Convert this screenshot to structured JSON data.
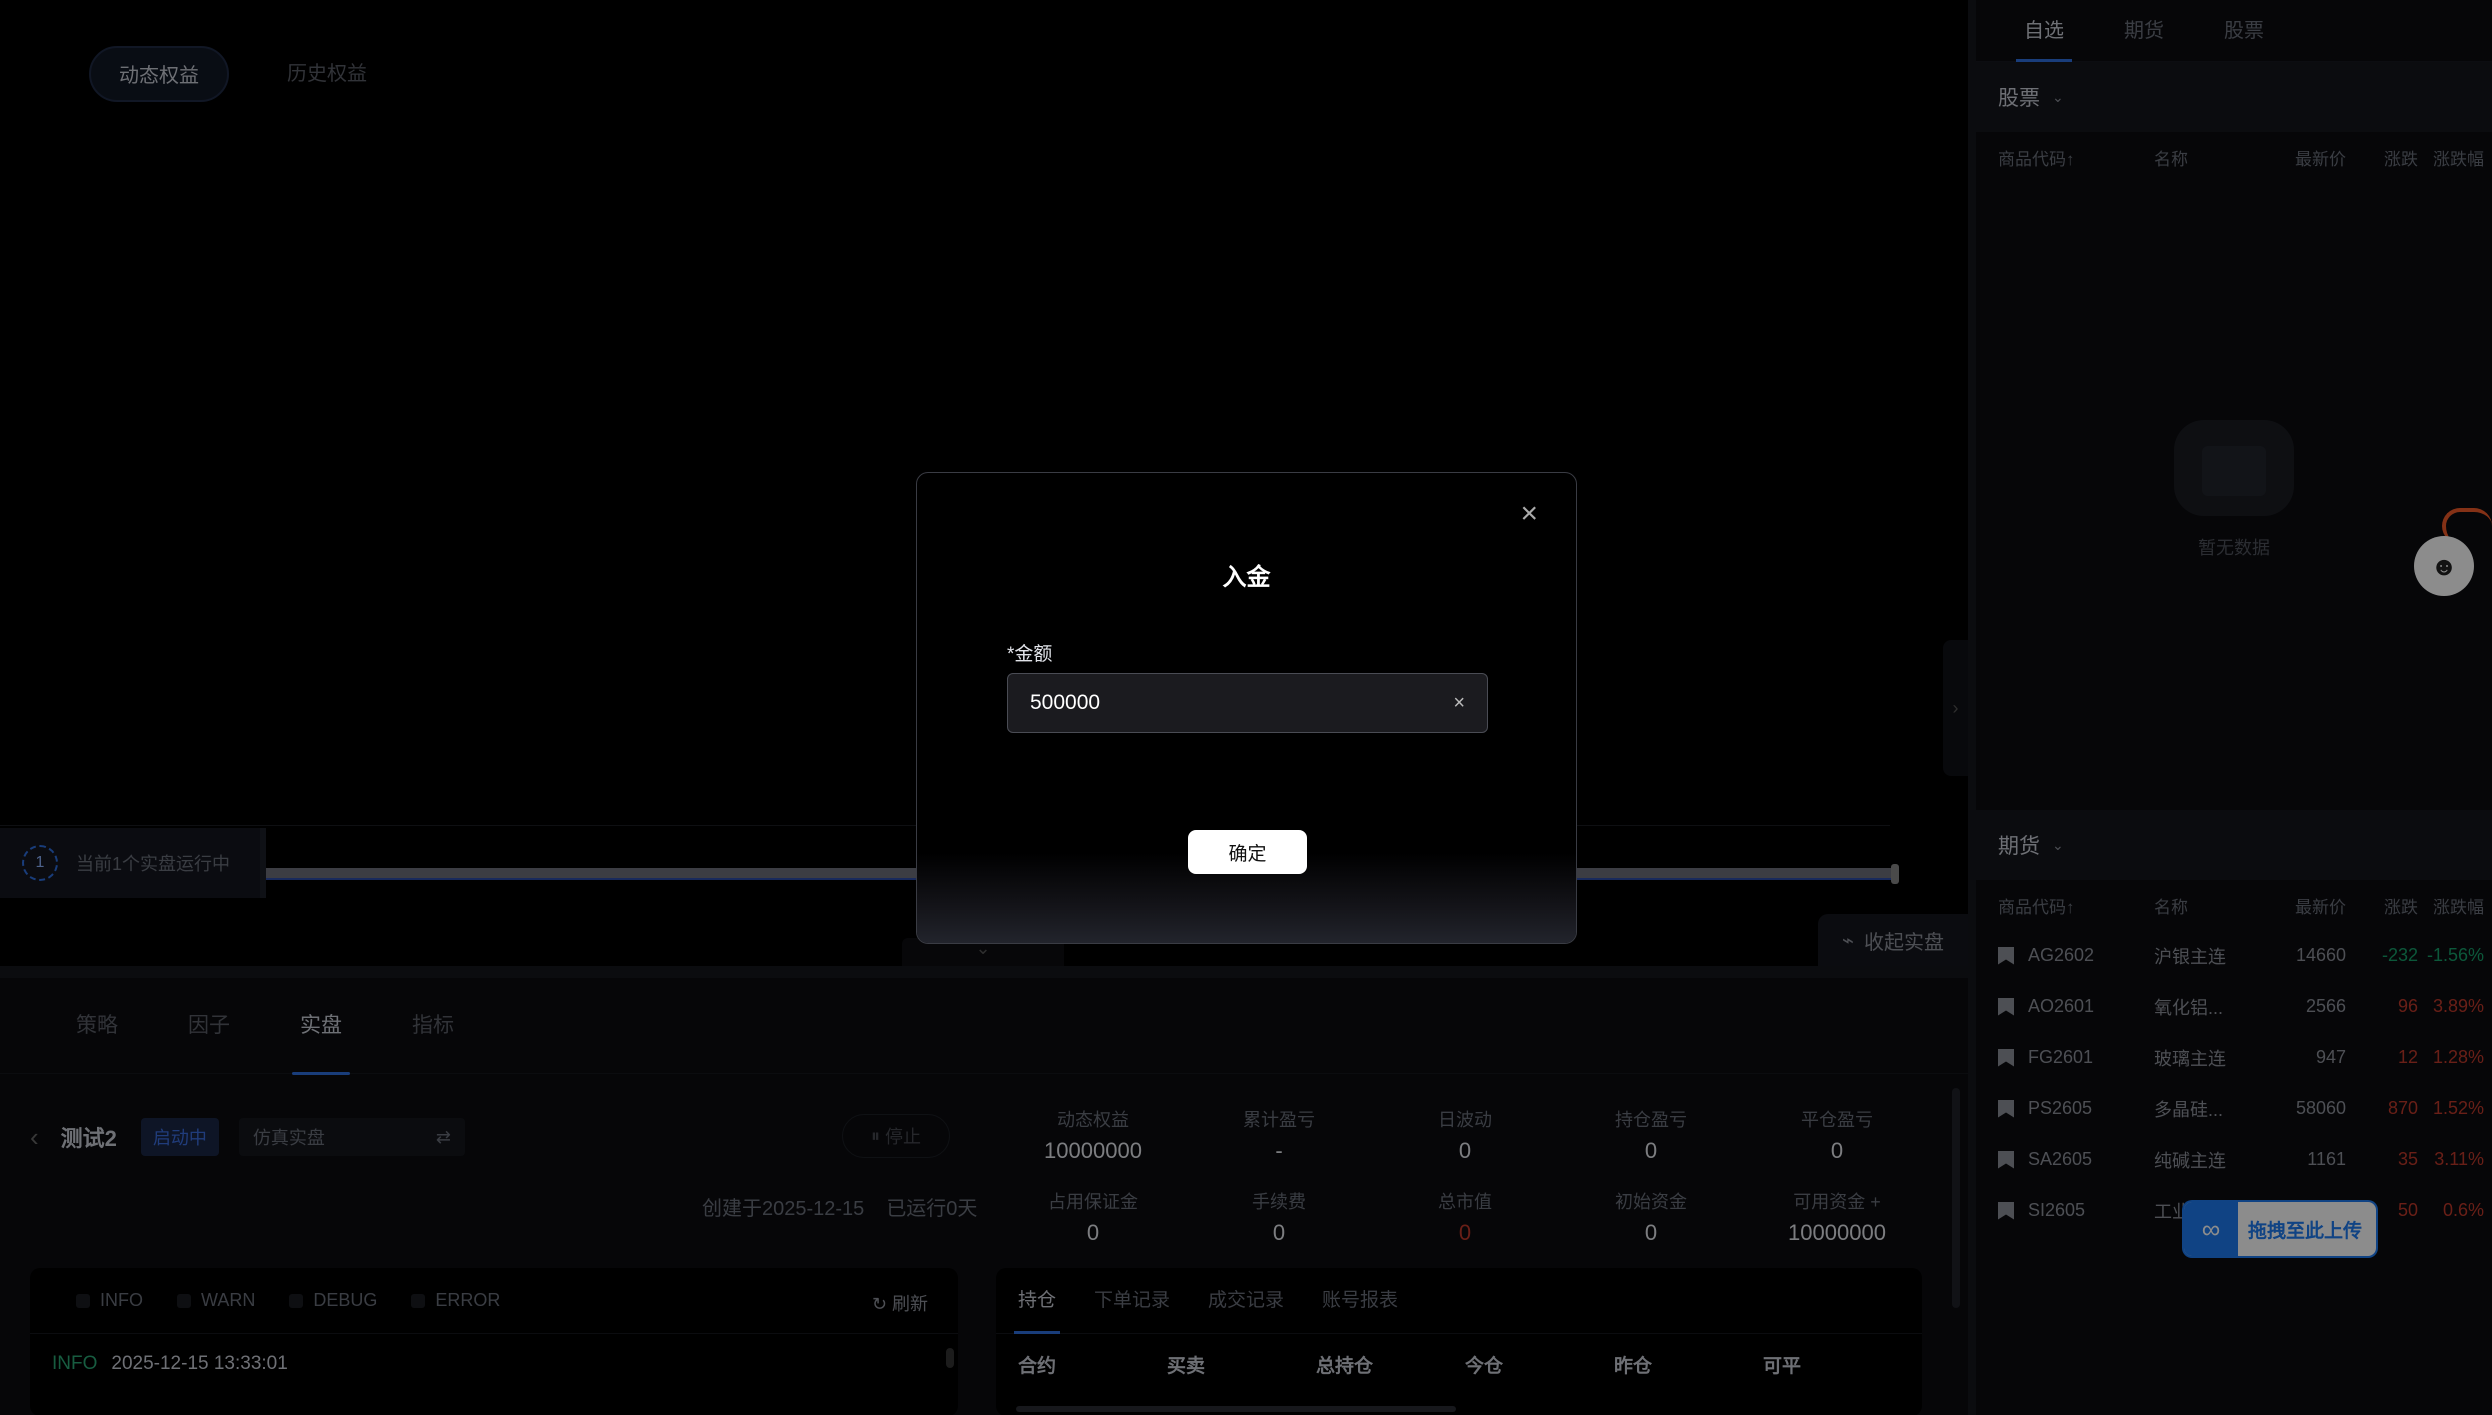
{
  "equity_tabs": {
    "dynamic": "动态权益",
    "history": "历史权益"
  },
  "running": {
    "count": "1",
    "text": "当前1个实盘运行中"
  },
  "collapse_live": "收起实盘",
  "bottom_tabs": [
    "策略",
    "因子",
    "实盘",
    "指标"
  ],
  "strategy": {
    "name": "测试2",
    "status": "启动中",
    "mode": "仿真实盘",
    "stop": "停止",
    "created": "创建于2025-12-15",
    "running_days": "已运行0天"
  },
  "stats": [
    {
      "label": "动态权益",
      "value": "10000000"
    },
    {
      "label": "累计盈亏",
      "value": "-"
    },
    {
      "label": "日波动",
      "value": "0"
    },
    {
      "label": "持仓盈亏",
      "value": "0"
    },
    {
      "label": "平仓盈亏",
      "value": "0"
    },
    {
      "label": "占用保证金",
      "value": "0"
    },
    {
      "label": "手续费",
      "value": "0"
    },
    {
      "label": "总市值",
      "value": "0"
    },
    {
      "label": "初始资金",
      "value": "0"
    },
    {
      "label": "可用资金",
      "value": "10000000"
    }
  ],
  "log": {
    "filters": [
      "INFO",
      "WARN",
      "DEBUG",
      "ERROR"
    ],
    "refresh": "刷新",
    "rows": [
      {
        "level": "INFO",
        "time": "2025-12-15 13:33:01"
      }
    ]
  },
  "positions": {
    "tabs": [
      "持仓",
      "下单记录",
      "成交记录",
      "账号报表"
    ],
    "headers": [
      "合约",
      "买卖",
      "总持仓",
      "今仓",
      "昨仓",
      "可平"
    ]
  },
  "sidebar": {
    "tabs": [
      "自选",
      "期货",
      "股票"
    ],
    "stock_section": "股票",
    "futures_section": "期货",
    "columns": [
      "商品代码↑",
      "名称",
      "最新价",
      "涨跌",
      "涨跌幅"
    ],
    "empty_text": "暂无数据",
    "futures": [
      {
        "code": "AG2602",
        "name": "沪银主连",
        "price": "14660",
        "change": "-232",
        "pct": "-1.56%",
        "dir": "down"
      },
      {
        "code": "AO2601",
        "name": "氧化铝...",
        "price": "2566",
        "change": "96",
        "pct": "3.89%",
        "dir": "up"
      },
      {
        "code": "FG2601",
        "name": "玻璃主连",
        "price": "947",
        "change": "12",
        "pct": "1.28%",
        "dir": "up"
      },
      {
        "code": "PS2605",
        "name": "多晶硅...",
        "price": "58060",
        "change": "870",
        "pct": "1.52%",
        "dir": "up"
      },
      {
        "code": "SA2605",
        "name": "纯碱主连",
        "price": "1161",
        "change": "35",
        "pct": "3.11%",
        "dir": "up"
      },
      {
        "code": "SI2605",
        "name": "工业...",
        "price": "",
        "change": "50",
        "pct": "0.6%",
        "dir": "up"
      }
    ]
  },
  "upload_chip": "拖拽至此上传",
  "modal": {
    "title": "入金",
    "field_label": "金额",
    "amount_value": "500000",
    "confirm": "确定"
  },
  "colors": {
    "accent": "#2f6fe0",
    "up": "#c0392b",
    "down": "#17a06b"
  }
}
